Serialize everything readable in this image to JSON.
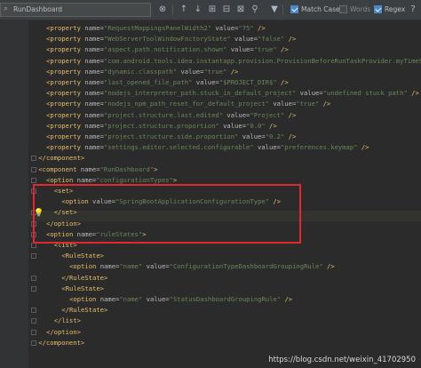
{
  "toolbar": {
    "search_text": "RunDashboard",
    "match_case_label": "Match Case",
    "match_case_checked": true,
    "words_label": "Words",
    "words_checked": false,
    "regex_label": "Regex",
    "regex_checked": true
  },
  "lines": [
    {
      "indent": 4,
      "parts": [
        [
          "tag",
          "<property "
        ],
        [
          "attr",
          "name="
        ],
        [
          "val",
          "\"RequestMappingsPanelWidth2\""
        ],
        [
          "attr",
          " value="
        ],
        [
          "val",
          "\"75\""
        ],
        [
          "tag",
          " />"
        ]
      ]
    },
    {
      "indent": 4,
      "parts": [
        [
          "tag",
          "<property "
        ],
        [
          "attr",
          "name="
        ],
        [
          "val",
          "\"WebServerToolWindowFactoryState\""
        ],
        [
          "attr",
          " value="
        ],
        [
          "val",
          "\"false\""
        ],
        [
          "tag",
          " />"
        ]
      ]
    },
    {
      "indent": 4,
      "parts": [
        [
          "tag",
          "<property "
        ],
        [
          "attr",
          "name="
        ],
        [
          "val",
          "\"aspect.path.notification.shown\""
        ],
        [
          "attr",
          " value="
        ],
        [
          "val",
          "\"true\""
        ],
        [
          "tag",
          " />"
        ]
      ]
    },
    {
      "indent": 4,
      "parts": [
        [
          "tag",
          "<property "
        ],
        [
          "attr",
          "name="
        ],
        [
          "val",
          "\"com.android.tools.idea.instantapp.provision.ProvisionBeforeRunTaskProvider.myTimeStamp"
        ]
      ]
    },
    {
      "indent": 4,
      "parts": [
        [
          "tag",
          "<property "
        ],
        [
          "attr",
          "name="
        ],
        [
          "val",
          "\"dynamic.classpath\""
        ],
        [
          "attr",
          " value="
        ],
        [
          "val",
          "\"true\""
        ],
        [
          "tag",
          " />"
        ]
      ]
    },
    {
      "indent": 4,
      "parts": [
        [
          "tag",
          "<property "
        ],
        [
          "attr",
          "name="
        ],
        [
          "val",
          "\"last_opened_file_path\""
        ],
        [
          "attr",
          " value="
        ],
        [
          "val",
          "\"$PROJECT_DIR$\""
        ],
        [
          "tag",
          " />"
        ]
      ]
    },
    {
      "indent": 4,
      "parts": [
        [
          "tag",
          "<property "
        ],
        [
          "attr",
          "name="
        ],
        [
          "val",
          "\"nodejs_interpreter_path.stuck_in_default_project\""
        ],
        [
          "attr",
          " value="
        ],
        [
          "val",
          "\"undefined stuck path\""
        ],
        [
          "tag",
          " />"
        ]
      ]
    },
    {
      "indent": 4,
      "parts": [
        [
          "tag",
          "<property "
        ],
        [
          "attr",
          "name="
        ],
        [
          "val",
          "\"nodejs_npm_path_reset_for_default_project\""
        ],
        [
          "attr",
          " value="
        ],
        [
          "val",
          "\"true\""
        ],
        [
          "tag",
          " />"
        ]
      ]
    },
    {
      "indent": 4,
      "parts": [
        [
          "tag",
          "<property "
        ],
        [
          "attr",
          "name="
        ],
        [
          "val",
          "\"project.structure.last.edited\""
        ],
        [
          "attr",
          " value="
        ],
        [
          "val",
          "\"Project\""
        ],
        [
          "tag",
          " />"
        ]
      ]
    },
    {
      "indent": 4,
      "parts": [
        [
          "tag",
          "<property "
        ],
        [
          "attr",
          "name="
        ],
        [
          "val",
          "\"project.structure.proportion\""
        ],
        [
          "attr",
          " value="
        ],
        [
          "val",
          "\"0.0\""
        ],
        [
          "tag",
          " />"
        ]
      ]
    },
    {
      "indent": 4,
      "parts": [
        [
          "tag",
          "<property "
        ],
        [
          "attr",
          "name="
        ],
        [
          "val",
          "\"project.structure.side.proportion\""
        ],
        [
          "attr",
          " value="
        ],
        [
          "val",
          "\"0.2\""
        ],
        [
          "tag",
          " />"
        ]
      ]
    },
    {
      "indent": 4,
      "parts": [
        [
          "tag",
          "<property "
        ],
        [
          "attr",
          "name="
        ],
        [
          "val",
          "\"settings.editor.selected.configurable\""
        ],
        [
          "attr",
          " value="
        ],
        [
          "val",
          "\"preferences.keymap\""
        ],
        [
          "tag",
          " />"
        ]
      ]
    },
    {
      "indent": 2,
      "parts": [
        [
          "tag",
          "</component>"
        ]
      ]
    },
    {
      "indent": 2,
      "parts": [
        [
          "tag",
          "<component "
        ],
        [
          "attr",
          "name="
        ],
        [
          "val",
          "\"RunDashboard\""
        ],
        [
          "tag",
          ">"
        ]
      ]
    },
    {
      "indent": 4,
      "parts": [
        [
          "tag",
          "<option "
        ],
        [
          "attr",
          "name="
        ],
        [
          "val",
          "\"configurationTypes\""
        ],
        [
          "tag",
          ">"
        ]
      ]
    },
    {
      "indent": 6,
      "parts": [
        [
          "tag",
          "<set>"
        ]
      ]
    },
    {
      "indent": 8,
      "parts": [
        [
          "tag",
          "<option "
        ],
        [
          "attr",
          "value="
        ],
        [
          "val",
          "\"SpringBootApplicationConfigurationType\""
        ],
        [
          "tag",
          " />"
        ]
      ]
    },
    {
      "indent": 6,
      "parts": [
        [
          "tag",
          "</set>"
        ]
      ]
    },
    {
      "indent": 4,
      "parts": [
        [
          "tag",
          "</option>"
        ]
      ]
    },
    {
      "indent": 4,
      "parts": [
        [
          "tag",
          "<option "
        ],
        [
          "attr",
          "name="
        ],
        [
          "val",
          "\"ruleStates\""
        ],
        [
          "tag",
          ">"
        ]
      ]
    },
    {
      "indent": 6,
      "parts": [
        [
          "tag",
          "<list>"
        ]
      ]
    },
    {
      "indent": 8,
      "parts": [
        [
          "tag",
          "<RuleState>"
        ]
      ]
    },
    {
      "indent": 10,
      "parts": [
        [
          "tag",
          "<option "
        ],
        [
          "attr",
          "name="
        ],
        [
          "val",
          "\"name\""
        ],
        [
          "attr",
          " value="
        ],
        [
          "val",
          "\"ConfigurationTypeDashboardGroupingRule\""
        ],
        [
          "tag",
          " />"
        ]
      ]
    },
    {
      "indent": 8,
      "parts": [
        [
          "tag",
          "</RuleState>"
        ]
      ]
    },
    {
      "indent": 8,
      "parts": [
        [
          "tag",
          "<RuleState>"
        ]
      ]
    },
    {
      "indent": 10,
      "parts": [
        [
          "tag",
          "<option "
        ],
        [
          "attr",
          "name="
        ],
        [
          "val",
          "\"name\""
        ],
        [
          "attr",
          " value="
        ],
        [
          "val",
          "\"StatusDashboardGroupingRule\""
        ],
        [
          "tag",
          " />"
        ]
      ]
    },
    {
      "indent": 8,
      "parts": [
        [
          "tag",
          "</RuleState>"
        ]
      ]
    },
    {
      "indent": 6,
      "parts": [
        [
          "tag",
          "</list>"
        ]
      ]
    },
    {
      "indent": 4,
      "parts": [
        [
          "tag",
          "</option>"
        ]
      ]
    },
    {
      "indent": 2,
      "parts": [
        [
          "tag",
          "</component>"
        ]
      ]
    }
  ],
  "watermark": "https://blog.csdn.net/weixin_41702950",
  "colors": {
    "background": "#2b2b2b",
    "tag": "#e8bf6a",
    "attribute": "#bababa",
    "string": "#6a8759",
    "highlight_box": "#e0282e"
  },
  "icons": [
    "search-icon",
    "arrow-up-icon",
    "arrow-down-icon",
    "find-all-icon",
    "select-all-icon",
    "filter-icon",
    "lightbulb-icon"
  ]
}
